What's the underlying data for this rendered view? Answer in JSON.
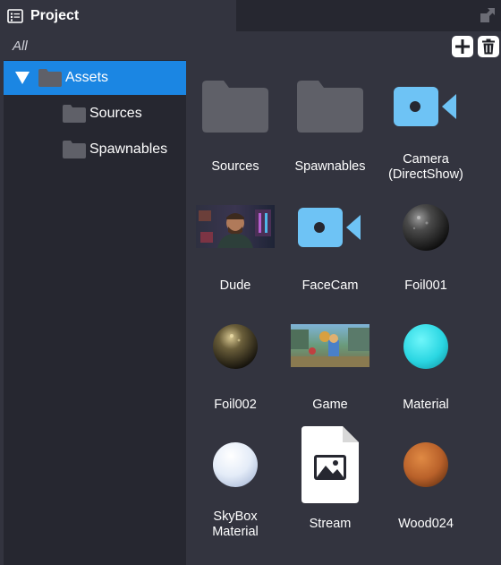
{
  "panel": {
    "title": "Project"
  },
  "filter": {
    "label": "All"
  },
  "tree": {
    "items": [
      {
        "label": "Assets",
        "expanded": true,
        "selected": true
      },
      {
        "label": "Sources"
      },
      {
        "label": "Spawnables"
      }
    ]
  },
  "assets": [
    {
      "label": "Sources",
      "kind": "folder-icon"
    },
    {
      "label": "Spawnables",
      "kind": "folder-icon"
    },
    {
      "label": "Camera\n(DirectShow)",
      "kind": "video-camera-icon"
    },
    {
      "label": "Dude",
      "kind": "texture-thumbnail"
    },
    {
      "label": "FaceCam",
      "kind": "video-camera-icon"
    },
    {
      "label": "Foil001",
      "kind": "material-sphere"
    },
    {
      "label": "Foil002",
      "kind": "material-sphere"
    },
    {
      "label": "Game",
      "kind": "texture-thumbnail"
    },
    {
      "label": "Material",
      "kind": "material-sphere"
    },
    {
      "label": "SkyBox\nMaterial",
      "kind": "material-sphere"
    },
    {
      "label": "Stream",
      "kind": "image-file-icon"
    },
    {
      "label": "Wood024",
      "kind": "material-sphere"
    }
  ],
  "colors": {
    "background": "#33343f",
    "tree_background": "#262730",
    "selection": "#1b86e3",
    "camera_icon": "#6ec3f5",
    "folder_icon": "#5f6068"
  }
}
